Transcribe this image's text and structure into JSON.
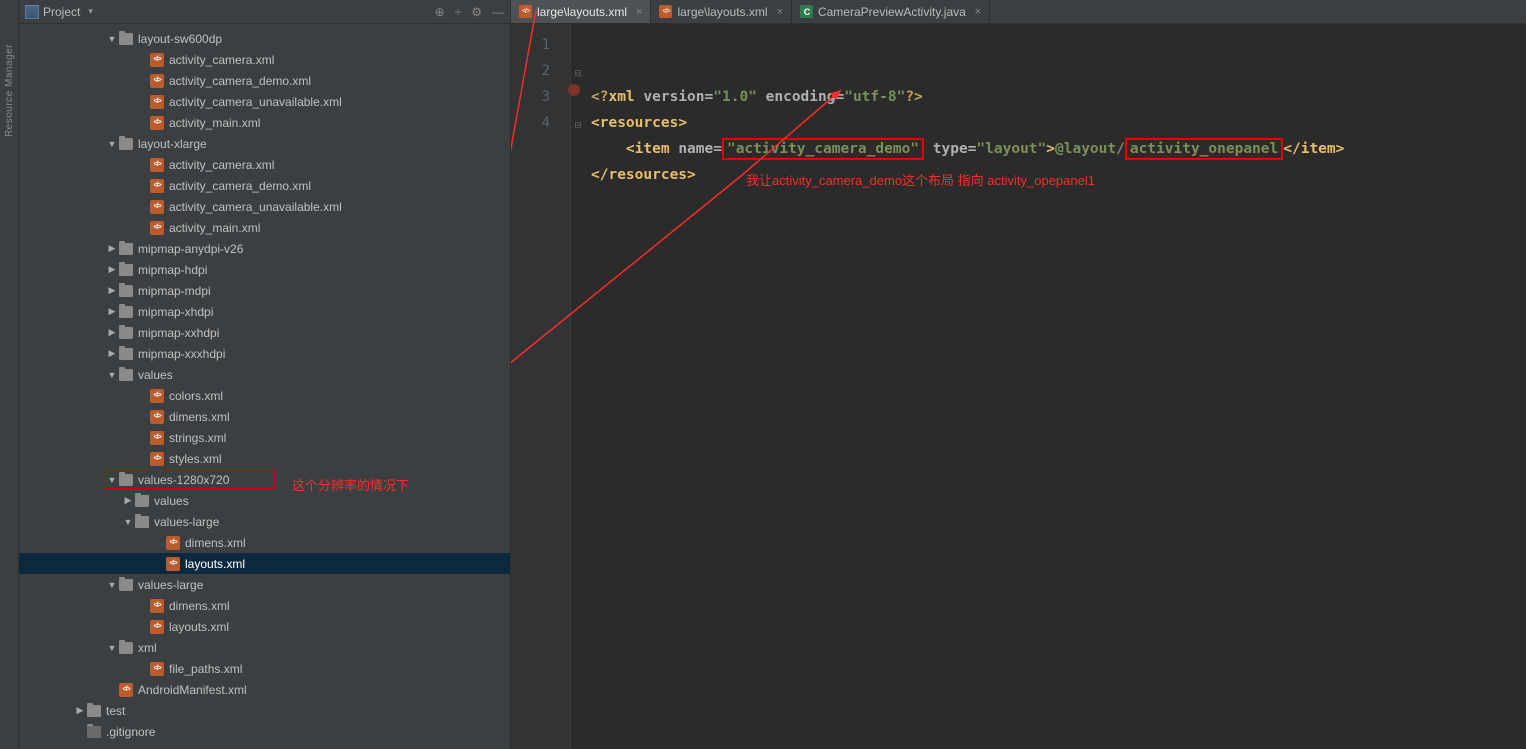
{
  "projectHeader": {
    "title": "Project"
  },
  "leftRail": {
    "text": "Resource Manager"
  },
  "treeGroups": [
    {
      "type": "folder-exp",
      "indent": 88,
      "label": "layout-sw600dp",
      "children": [
        {
          "type": "xml",
          "indent": 119,
          "label": "activity_camera.xml"
        },
        {
          "type": "xml",
          "indent": 119,
          "label": "activity_camera_demo.xml"
        },
        {
          "type": "xml",
          "indent": 119,
          "label": "activity_camera_unavailable.xml"
        },
        {
          "type": "xml",
          "indent": 119,
          "label": "activity_main.xml"
        }
      ]
    },
    {
      "type": "folder-exp",
      "indent": 88,
      "label": "layout-xlarge",
      "children": [
        {
          "type": "xml",
          "indent": 119,
          "label": "activity_camera.xml"
        },
        {
          "type": "xml",
          "indent": 119,
          "label": "activity_camera_demo.xml"
        },
        {
          "type": "xml",
          "indent": 119,
          "label": "activity_camera_unavailable.xml"
        },
        {
          "type": "xml",
          "indent": 119,
          "label": "activity_main.xml"
        }
      ]
    },
    {
      "type": "folder-col",
      "indent": 88,
      "label": "mipmap-anydpi-v26"
    },
    {
      "type": "folder-col",
      "indent": 88,
      "label": "mipmap-hdpi"
    },
    {
      "type": "folder-col",
      "indent": 88,
      "label": "mipmap-mdpi"
    },
    {
      "type": "folder-col",
      "indent": 88,
      "label": "mipmap-xhdpi"
    },
    {
      "type": "folder-col",
      "indent": 88,
      "label": "mipmap-xxhdpi"
    },
    {
      "type": "folder-col",
      "indent": 88,
      "label": "mipmap-xxxhdpi"
    },
    {
      "type": "folder-exp",
      "indent": 88,
      "label": "values",
      "children": [
        {
          "type": "xml",
          "indent": 119,
          "label": "colors.xml"
        },
        {
          "type": "xml",
          "indent": 119,
          "label": "dimens.xml"
        },
        {
          "type": "xml",
          "indent": 119,
          "label": "strings.xml"
        },
        {
          "type": "xml",
          "indent": 119,
          "label": "styles.xml"
        }
      ]
    },
    {
      "type": "folder-exp",
      "indent": 88,
      "label": "values-1280x720",
      "boxed": true,
      "children": [
        {
          "type": "folder-col",
          "indent": 104,
          "label": "values"
        },
        {
          "type": "folder-exp",
          "indent": 104,
          "label": "values-large",
          "children": [
            {
              "type": "xml",
              "indent": 135,
              "label": "dimens.xml"
            },
            {
              "type": "xml",
              "indent": 135,
              "label": "layouts.xml",
              "selected": true
            }
          ]
        }
      ]
    },
    {
      "type": "folder-exp",
      "indent": 88,
      "label": "values-large",
      "children": [
        {
          "type": "xml",
          "indent": 119,
          "label": "dimens.xml"
        },
        {
          "type": "xml",
          "indent": 119,
          "label": "layouts.xml"
        }
      ]
    },
    {
      "type": "folder-exp",
      "indent": 88,
      "label": "xml",
      "children": [
        {
          "type": "xml",
          "indent": 119,
          "label": "file_paths.xml"
        }
      ]
    },
    {
      "type": "xml",
      "indent": 88,
      "label": "AndroidManifest.xml"
    },
    {
      "type": "folder-col",
      "indent": 56,
      "label": "test"
    },
    {
      "type": "file",
      "indent": 56,
      "label": ".gitignore"
    }
  ],
  "tabs": [
    {
      "label": "large\\layouts.xml",
      "icon": "xml",
      "active": true
    },
    {
      "label": "large\\layouts.xml",
      "icon": "xml",
      "active": false
    },
    {
      "label": "CameraPreviewActivity.java",
      "icon": "java",
      "active": false
    }
  ],
  "gutterLines": [
    "1",
    "2",
    "3",
    "4"
  ],
  "code": {
    "line1": {
      "pi_open": "<?",
      "xml": "xml",
      "version_k": "version",
      "version_v": "\"1.0\"",
      "enc_k": "encoding",
      "enc_v": "\"utf-8\"",
      "pi_close": "?>"
    },
    "line2": {
      "open": "<",
      "tag": "resources",
      "close": ">"
    },
    "line3": {
      "lt": "<",
      "tag": "item",
      "name_k": "name",
      "name_v": "\"activity_camera_demo\"",
      "type_k": "type",
      "type_v": "\"layout\"",
      "gt": ">",
      "textA": "@layout/",
      "textB": "activity_onepanel",
      "ct_open": "</",
      "ct_tag": "item",
      "ct_close": ">"
    },
    "line4": {
      "open": "</",
      "tag": "resources",
      "close": ">"
    }
  },
  "annotations": {
    "a1": "这个分辨率的情况下",
    "a2": "我让activity_camera_demo这个布局 指向 activity_opepanel1"
  }
}
